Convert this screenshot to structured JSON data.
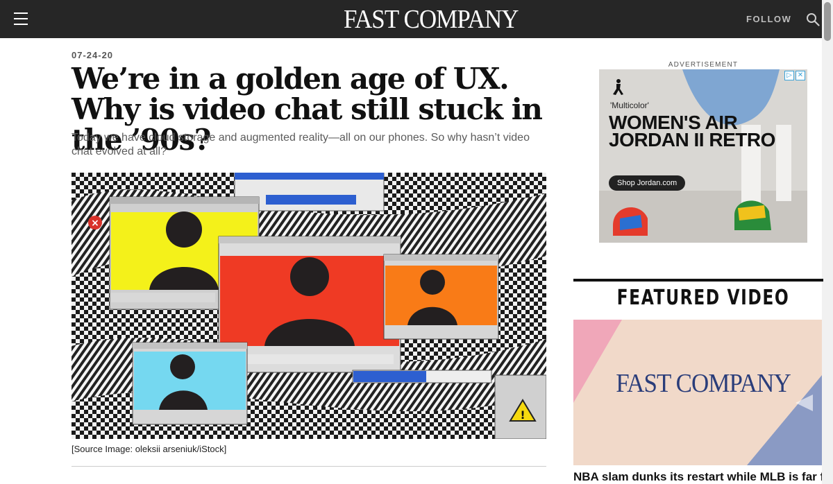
{
  "header": {
    "brand": "FAST COMPANY",
    "follow_label": "FOLLOW",
    "menu_icon": "hamburger-menu-icon",
    "search_icon": "search-icon",
    "bar_color": "#262626"
  },
  "article": {
    "date": "07-24-20",
    "headline": "We’re in a golden age of UX. Why is video chat still stuck in the ’90s?",
    "deck": "Today we have cloud storage and augmented reality—all on our phones. So why hasn’t video chat evolved at all?",
    "image_credit": "[Source Image: oleksii arseniuk/iStock]"
  },
  "sidebar": {
    "ad_label": "ADVERTISEMENT",
    "ad": {
      "colorway": "'Multicolor'",
      "title": "WOMEN'S AIR JORDAN II RETRO",
      "cta": "Shop Jordan.com",
      "badge_icons": [
        "adchoices-icon",
        "close-icon"
      ]
    },
    "featured_video": {
      "title": "FEATURED VIDEO",
      "logo": "FAST COMPANY",
      "caption": "NBA slam dunks its restart while MLB is far from"
    }
  }
}
